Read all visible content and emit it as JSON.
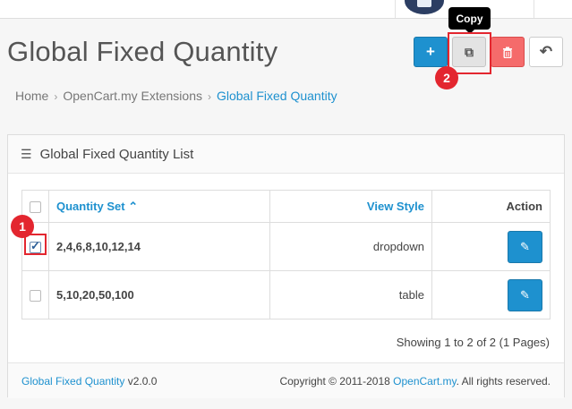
{
  "header": {
    "title": "Global Fixed Quantity"
  },
  "toolbar": {
    "add_icon": "+",
    "copy_icon": "⧉",
    "delete_icon": "🗑",
    "back_icon": "↶",
    "tooltip": "Copy"
  },
  "markers": {
    "one": "1",
    "two": "2"
  },
  "breadcrumb": {
    "home": "Home",
    "extensions": "OpenCart.my Extensions",
    "current": "Global Fixed Quantity",
    "separator": "›"
  },
  "panel": {
    "heading": "Global Fixed Quantity List",
    "columns": {
      "quantity_set": "Quantity Set",
      "sort_arrow": "⌃",
      "view_style": "View Style",
      "action": "Action"
    },
    "rows": [
      {
        "quantity_set": "2,4,6,8,10,12,14",
        "view_style": "dropdown",
        "checked": true
      },
      {
        "quantity_set": "5,10,20,50,100",
        "view_style": "table",
        "checked": false
      }
    ],
    "pagination": "Showing 1 to 2 of 2 (1 Pages)"
  },
  "footer": {
    "ext_name": "Global Fixed Quantity",
    "version": "v2.0.0",
    "copyright_prefix": "Copyright © 2011-2018",
    "company": "OpenCart.my",
    "rights": ". All rights reserved."
  },
  "colors": {
    "primary": "#1e91cf",
    "danger": "#f56b6b",
    "highlight": "#e3262f"
  }
}
